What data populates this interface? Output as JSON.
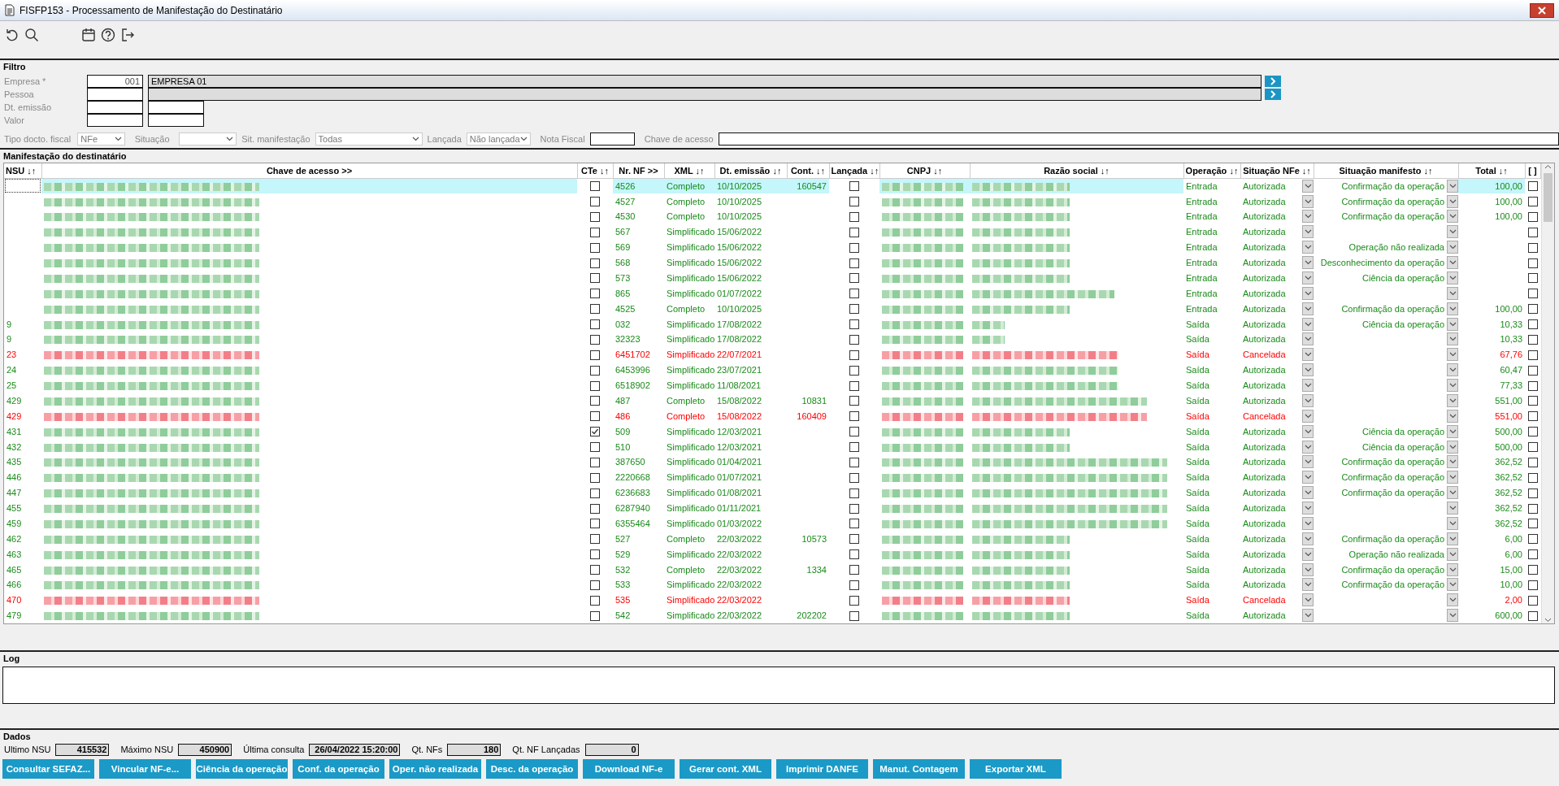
{
  "window": {
    "title": "FISFP153 - Processamento de Manifestação do Destinatário"
  },
  "filter": {
    "title": "Filtro",
    "fields": [
      {
        "label": "Empresa *",
        "code": "001",
        "name": "EMPRESA 01",
        "lookup": true
      },
      {
        "label": "Pessoa",
        "lookup": true
      },
      {
        "label": "Dt. emissão",
        "lookup": false
      },
      {
        "label": "Valor",
        "lookup": false
      }
    ],
    "selects": [
      {
        "label": "Tipo docto. fiscal",
        "value": "NFe"
      },
      {
        "label": "Situação"
      },
      {
        "label": "Sit. manifestação",
        "value": "Todas"
      },
      {
        "label": "Lançada",
        "value": "Não lançada"
      }
    ],
    "inputs": [
      {
        "label": "Nota Fiscal"
      },
      {
        "label": "Chave de acesso"
      }
    ]
  },
  "table": {
    "title": "Manifestação do destinatário",
    "columns": [
      "NSU ↓↑",
      "Chave de acesso >>",
      "CTe ↓↑",
      "Nr. NF >>",
      "XML ↓↑",
      "Dt. emissão ↓↑",
      "Cont. ↓↑",
      "Lançada ↓↑",
      "CNPJ ↓↑",
      "Razão social ↓↑",
      "Operação ↓↑",
      "Situação NFe ↓↑",
      "Situação manifesto ↓↑",
      "Total ↓↑",
      "[ ]"
    ],
    "rows": [
      {
        "nf": "4526",
        "xml": "Completo",
        "date": "10/10/2025",
        "cont": "160547",
        "operation": "Entrada",
        "status": "Autorizada",
        "manifest": "Confirmação da operação",
        "total": "100,00",
        "cte": false,
        "posted": false,
        "marked": false,
        "cancelled": false,
        "selected": true
      },
      {
        "nf": "4527",
        "xml": "Completo",
        "date": "10/10/2025",
        "operation": "Entrada",
        "status": "Autorizada",
        "manifest": "Confirmação da operação",
        "total": "100,00",
        "cte": false,
        "posted": false,
        "marked": false,
        "cancelled": false,
        "selected": false
      },
      {
        "nf": "4530",
        "xml": "Completo",
        "date": "10/10/2025",
        "operation": "Entrada",
        "status": "Autorizada",
        "manifest": "Confirmação da operação",
        "total": "100,00",
        "cte": false,
        "posted": false,
        "marked": false,
        "cancelled": false,
        "selected": false
      },
      {
        "nf": "567",
        "xml": "Simplificado",
        "date": "15/06/2022",
        "operation": "Entrada",
        "status": "Autorizada",
        "cte": false,
        "posted": false,
        "marked": false,
        "cancelled": false,
        "selected": false
      },
      {
        "nf": "569",
        "xml": "Simplificado",
        "date": "15/06/2022",
        "operation": "Entrada",
        "status": "Autorizada",
        "manifest": "Operação não realizada",
        "cte": false,
        "posted": false,
        "marked": false,
        "cancelled": false,
        "selected": false
      },
      {
        "nf": "568",
        "xml": "Simplificado",
        "date": "15/06/2022",
        "operation": "Entrada",
        "status": "Autorizada",
        "manifest": "Desconhecimento da operação",
        "cte": false,
        "posted": false,
        "marked": false,
        "cancelled": false,
        "selected": false
      },
      {
        "nf": "573",
        "xml": "Simplificado",
        "date": "15/06/2022",
        "operation": "Entrada",
        "status": "Autorizada",
        "manifest": "Ciência da operação",
        "cte": false,
        "posted": false,
        "marked": false,
        "cancelled": false,
        "selected": false
      },
      {
        "nf": "865",
        "xml": "Simplificado",
        "date": "01/07/2022",
        "operation": "Entrada",
        "status": "Autorizada",
        "cte": false,
        "posted": false,
        "marked": false,
        "cancelled": false,
        "selected": false
      },
      {
        "nf": "4525",
        "xml": "Completo",
        "date": "10/10/2025",
        "operation": "Entrada",
        "status": "Autorizada",
        "manifest": "Confirmação da operação",
        "total": "100,00",
        "cte": false,
        "posted": false,
        "marked": false,
        "cancelled": false,
        "selected": false
      },
      {
        "nsu": "9",
        "nf": "032",
        "xml": "Simplificado",
        "date": "17/08/2022",
        "operation": "Saída",
        "status": "Autorizada",
        "manifest": "Ciência da operação",
        "total": "10,33",
        "cte": false,
        "posted": false,
        "marked": false,
        "cancelled": false,
        "selected": false
      },
      {
        "nsu": "9",
        "nf": "32323",
        "xml": "Simplificado",
        "date": "17/08/2022",
        "operation": "Saída",
        "status": "Autorizada",
        "total": "10,33",
        "cte": false,
        "posted": false,
        "marked": false,
        "cancelled": false,
        "selected": false
      },
      {
        "nsu": "23",
        "nf": "6451702",
        "xml": "Simplificado",
        "date": "22/07/2021",
        "operation": "Saída",
        "status": "Cancelada",
        "total": "67,76",
        "cte": false,
        "posted": false,
        "marked": false,
        "cancelled": true,
        "selected": false
      },
      {
        "nsu": "24",
        "nf": "6453996",
        "xml": "Simplificado",
        "date": "23/07/2021",
        "operation": "Saída",
        "status": "Autorizada",
        "total": "60,47",
        "cte": false,
        "posted": false,
        "marked": false,
        "cancelled": false,
        "selected": false
      },
      {
        "nsu": "25",
        "nf": "6518902",
        "xml": "Simplificado",
        "date": "11/08/2021",
        "operation": "Saída",
        "status": "Autorizada",
        "total": "77,33",
        "cte": false,
        "posted": false,
        "marked": false,
        "cancelled": false,
        "selected": false
      },
      {
        "nsu": "429",
        "nf": "487",
        "xml": "Completo",
        "date": "15/08/2022",
        "cont": "10831",
        "operation": "Saída",
        "status": "Autorizada",
        "total": "551,00",
        "cte": false,
        "posted": false,
        "marked": false,
        "cancelled": false,
        "selected": false
      },
      {
        "nsu": "429",
        "nf": "486",
        "xml": "Completo",
        "date": "15/08/2022",
        "cont": "160409",
        "operation": "Saída",
        "status": "Cancelada",
        "total": "551,00",
        "cte": false,
        "posted": false,
        "marked": false,
        "cancelled": true,
        "selected": false
      },
      {
        "nsu": "431",
        "nf": "509",
        "xml": "Simplificado",
        "date": "12/03/2021",
        "operation": "Saída",
        "status": "Autorizada",
        "manifest": "Ciência da operação",
        "total": "500,00",
        "cte": true,
        "posted": false,
        "marked": false,
        "cancelled": false,
        "selected": false
      },
      {
        "nsu": "432",
        "nf": "510",
        "xml": "Simplificado",
        "date": "12/03/2021",
        "operation": "Saída",
        "status": "Autorizada",
        "manifest": "Ciência da operação",
        "total": "500,00",
        "cte": false,
        "posted": false,
        "marked": false,
        "cancelled": false,
        "selected": false
      },
      {
        "nsu": "435",
        "nf": "387650",
        "xml": "Simplificado",
        "date": "01/04/2021",
        "operation": "Saída",
        "status": "Autorizada",
        "manifest": "Confirmação da operação",
        "total": "362,52",
        "cte": false,
        "posted": false,
        "marked": false,
        "cancelled": false,
        "selected": false
      },
      {
        "nsu": "446",
        "nf": "2220668",
        "xml": "Simplificado",
        "date": "01/07/2021",
        "operation": "Saída",
        "status": "Autorizada",
        "manifest": "Confirmação da operação",
        "total": "362,52",
        "cte": false,
        "posted": false,
        "marked": false,
        "cancelled": false,
        "selected": false
      },
      {
        "nsu": "447",
        "nf": "6236683",
        "xml": "Simplificado",
        "date": "01/08/2021",
        "operation": "Saída",
        "status": "Autorizada",
        "manifest": "Confirmação da operação",
        "total": "362,52",
        "cte": false,
        "posted": false,
        "marked": false,
        "cancelled": false,
        "selected": false
      },
      {
        "nsu": "455",
        "nf": "6287940",
        "xml": "Simplificado",
        "date": "01/11/2021",
        "operation": "Saída",
        "status": "Autorizada",
        "total": "362,52",
        "cte": false,
        "posted": false,
        "marked": false,
        "cancelled": false,
        "selected": false
      },
      {
        "nsu": "459",
        "nf": "6355464",
        "xml": "Simplificado",
        "date": "01/03/2022",
        "operation": "Saída",
        "status": "Autorizada",
        "total": "362,52",
        "cte": false,
        "posted": false,
        "marked": false,
        "cancelled": false,
        "selected": false
      },
      {
        "nsu": "462",
        "nf": "527",
        "xml": "Completo",
        "date": "22/03/2022",
        "cont": "10573",
        "operation": "Saída",
        "status": "Autorizada",
        "manifest": "Confirmação da operação",
        "total": "6,00",
        "cte": false,
        "posted": false,
        "marked": false,
        "cancelled": false,
        "selected": false
      },
      {
        "nsu": "463",
        "nf": "529",
        "xml": "Simplificado",
        "date": "22/03/2022",
        "operation": "Saída",
        "status": "Autorizada",
        "manifest": "Operação não realizada",
        "total": "6,00",
        "cte": false,
        "posted": false,
        "marked": false,
        "cancelled": false,
        "selected": false
      },
      {
        "nsu": "465",
        "nf": "532",
        "xml": "Completo",
        "date": "22/03/2022",
        "cont": "1334",
        "operation": "Saída",
        "status": "Autorizada",
        "manifest": "Confirmação da operação",
        "total": "15,00",
        "cte": false,
        "posted": false,
        "marked": false,
        "cancelled": false,
        "selected": false
      },
      {
        "nsu": "466",
        "nf": "533",
        "xml": "Simplificado",
        "date": "22/03/2022",
        "operation": "Saída",
        "status": "Autorizada",
        "manifest": "Confirmação da operação",
        "total": "10,00",
        "cte": false,
        "posted": false,
        "marked": false,
        "cancelled": false,
        "selected": false
      },
      {
        "nsu": "470",
        "nf": "535",
        "xml": "Simplificado",
        "date": "22/03/2022",
        "operation": "Saída",
        "status": "Cancelada",
        "total": "2,00",
        "cte": false,
        "posted": false,
        "marked": false,
        "cancelled": true,
        "selected": false
      },
      {
        "nsu": "479",
        "nf": "542",
        "xml": "Simplificado",
        "date": "22/03/2022",
        "cont": "202202",
        "operation": "Saída",
        "status": "Autorizada",
        "total": "600,00",
        "cte": false,
        "posted": false,
        "marked": false,
        "cancelled": false,
        "selected": false
      }
    ]
  },
  "log": {
    "title": "Log"
  },
  "data": {
    "title": "Dados",
    "fields": [
      {
        "label": "Ultimo NSU",
        "value": "415532"
      },
      {
        "label": "Máximo NSU",
        "value": "450900"
      },
      {
        "label": "Última consulta",
        "value": "26/04/2022 15:20:00"
      },
      {
        "label": "Qt. NFs",
        "value": "180"
      },
      {
        "label": "Qt. NF Lançadas",
        "value": "0"
      }
    ]
  },
  "buttons": [
    "Consultar SEFAZ...",
    "Vincular NF-e...",
    "Ciência da operação",
    "Conf. da operação",
    "Oper. não realizada",
    "Desc. da operação",
    "Download NF-e",
    "Gerar cont. XML",
    "Imprimir DANFE",
    "Manut. Contagem",
    "Exportar XML"
  ]
}
